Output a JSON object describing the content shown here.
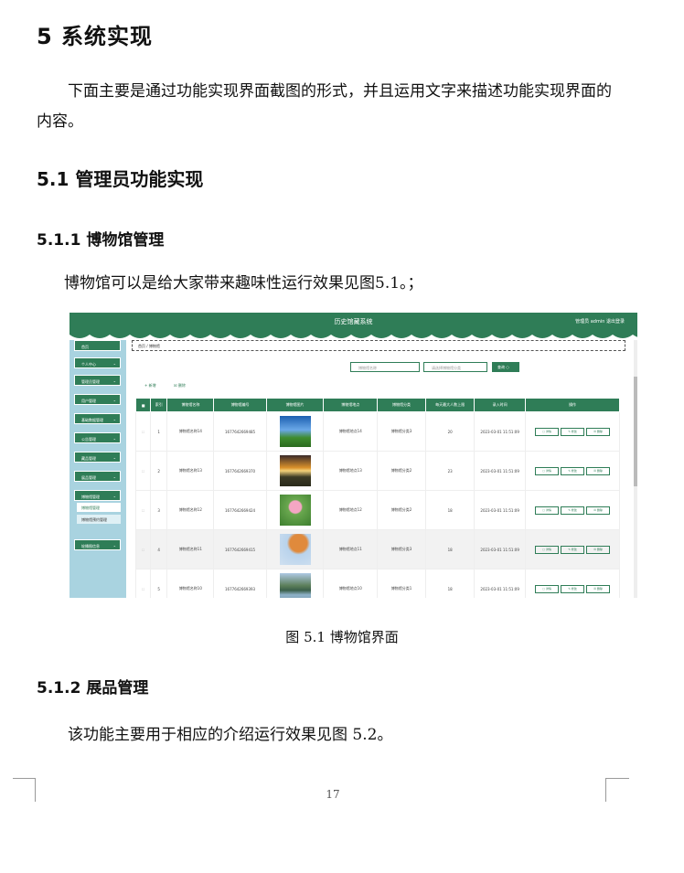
{
  "heading1": "5  系统实现",
  "intro": "下面主要是通过功能实现界面截图的形式，并且运用文字来描述功能实现界面的内容。",
  "heading2": "5.1  管理员功能实现",
  "heading3a": "5.1.1  博物馆管理",
  "para_a": "博物馆可以是给大家带来趣味性运行效果见图5.1。；",
  "caption": "图 5.1  博物馆界面",
  "heading3b": "5.1.2  展品管理",
  "para_b": "该功能主要用于相应的介绍运行效果见图 5.2。",
  "page_number": "17",
  "screenshot": {
    "app_title": "历史馆藏系统",
    "user_info": "管理员 admin    退出登录",
    "breadcrumb": "首页 / 博物馆",
    "search_placeholder_1": "博物馆名称",
    "search_placeholder_2": "请选择博物馆分类",
    "query_label": "查询 ○",
    "add_label": "+ 新增",
    "delete_label": "☒ 删除",
    "sidebar": [
      {
        "label": "首页",
        "arrow": ""
      },
      {
        "label": "个人中心",
        "arrow": "⌄"
      },
      {
        "label": "管理员管理",
        "arrow": "⌄"
      },
      {
        "label": "用户管理",
        "arrow": "⌄"
      },
      {
        "label": "基础数据管理",
        "arrow": "⌄"
      },
      {
        "label": "公告管理",
        "arrow": "⌄"
      },
      {
        "label": "藏品管理",
        "arrow": "⌄"
      },
      {
        "label": "展品管理",
        "arrow": "⌄"
      },
      {
        "label": "博物馆管理",
        "arrow": "⌄"
      }
    ],
    "sub_items": [
      "博物馆管理",
      "博物馆预约管理"
    ],
    "sidebar_last": {
      "label": "轮播图信息",
      "arrow": "⌄"
    },
    "columns": [
      "",
      "索引",
      "博物馆名称",
      "博物馆编号",
      "博物馆图片",
      "博物馆地点",
      "博物馆分类",
      "每天最大人数上限",
      "录入时间",
      "操作"
    ],
    "rows": [
      {
        "idx": "1",
        "name": "博物馆名称14",
        "code": "1677642669485",
        "place": "博物馆地点14",
        "type": "博物馆分类3",
        "max": "20",
        "time": "2023-03-01 11:51:09",
        "img": "sky"
      },
      {
        "idx": "2",
        "name": "博物馆名称13",
        "code": "1677642669370",
        "place": "博物馆地点13",
        "type": "博物馆分类2",
        "max": "23",
        "time": "2023-03-01 11:51:09",
        "img": "sunset"
      },
      {
        "idx": "3",
        "name": "博物馆名称12",
        "code": "1677642669424",
        "place": "博物馆地点12",
        "type": "博物馆分类2",
        "max": "18",
        "time": "2023-03-01 11:51:09",
        "img": "flower"
      },
      {
        "idx": "4",
        "name": "博物馆名称11",
        "code": "1677642669415",
        "place": "博物馆地点11",
        "type": "博物馆分类3",
        "max": "18",
        "time": "2023-03-01 11:51:09",
        "img": "tree"
      },
      {
        "idx": "5",
        "name": "博物馆名称10",
        "code": "1677642669393",
        "place": "博物馆地点10",
        "type": "博物馆分类1",
        "max": "18",
        "time": "2023-03-01 11:51:09",
        "img": "lake"
      }
    ],
    "ops": [
      "▢ 详情",
      "✎ 修改",
      "☒ 删除"
    ]
  }
}
